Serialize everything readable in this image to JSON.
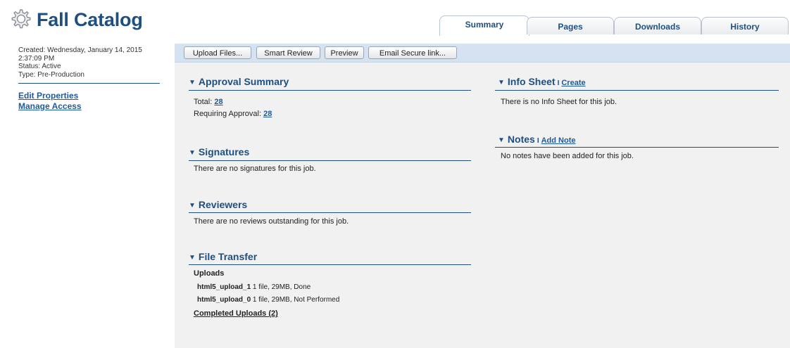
{
  "header": {
    "title": "Fall Catalog",
    "logo_icon": "gear-icon",
    "tabs": [
      {
        "label": "Summary",
        "active": true
      },
      {
        "label": "Pages",
        "active": false
      },
      {
        "label": "Downloads",
        "active": false
      },
      {
        "label": "History",
        "active": false
      }
    ]
  },
  "sidebar": {
    "created_line1": "Created: Wednesday, January 14, 2015",
    "created_line2": "2:37:09 PM",
    "status": "Status: Active",
    "type": "Type: Pre-Production",
    "links": [
      "Edit Properties",
      "Manage Access"
    ]
  },
  "toolbar": {
    "buttons": [
      "Upload Files...",
      "Smart Review",
      "Preview",
      "Email Secure link..."
    ]
  },
  "approval": {
    "title": "Approval Summary",
    "total_label": "Total:",
    "total_value": "28",
    "requiring_label": "Requiring Approval:",
    "requiring_value": "28"
  },
  "signatures": {
    "title": "Signatures",
    "text": "There are no signatures for this job."
  },
  "reviewers": {
    "title": "Reviewers",
    "text": "There are no reviews outstanding for this job."
  },
  "file_transfer": {
    "title": "File Transfer",
    "uploads_label": "Uploads",
    "uploads": [
      {
        "name": "html5_upload_1",
        "detail": "1 file, 29MB, Done"
      },
      {
        "name": "html5_upload_0",
        "detail": "1 file, 29MB, Not Performed"
      }
    ],
    "completed_link": "Completed Uploads (2)"
  },
  "info_sheet": {
    "title": "Info Sheet",
    "action": "Create",
    "text": "There is no Info Sheet for this job."
  },
  "notes": {
    "title": "Notes",
    "action": "Add Note",
    "text": "No notes have been added for this job."
  },
  "colors": {
    "brand": "#1e4f80",
    "link": "#1f5a9c",
    "toolbar_bg": "#d5e2f1",
    "panel_bg": "#f1f1f1"
  }
}
